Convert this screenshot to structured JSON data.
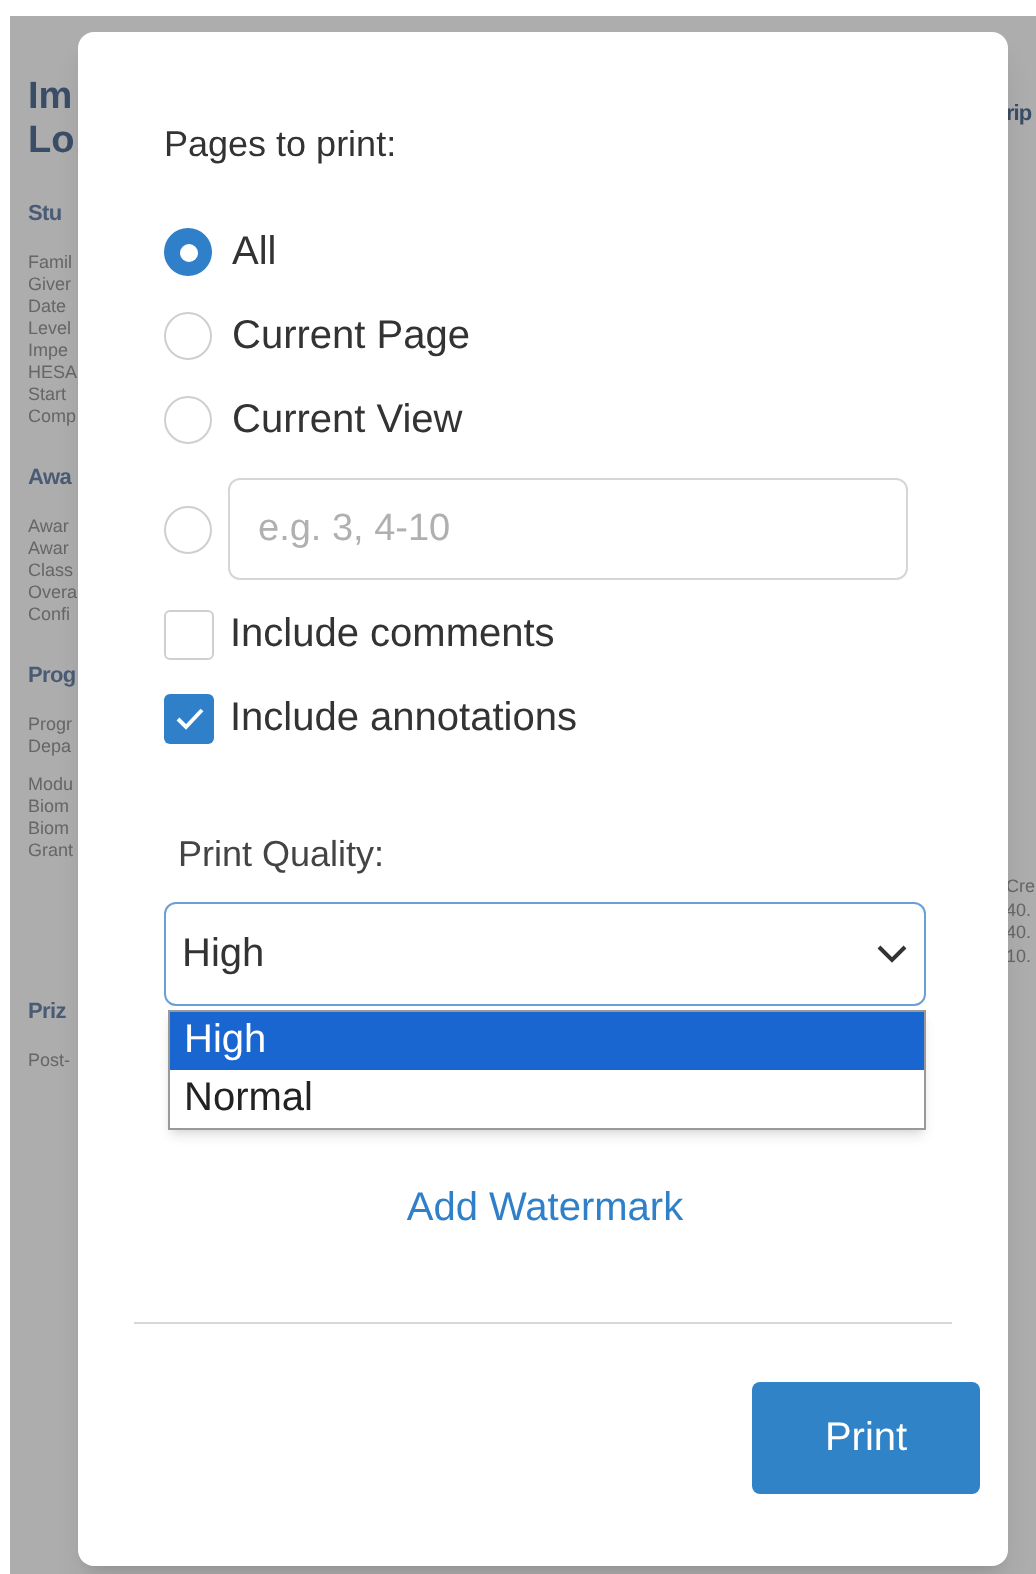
{
  "background": {
    "left": {
      "title": [
        "Im",
        "Lo"
      ],
      "sections": [
        {
          "heading": "Stu",
          "groups": [
            [
              "Famil",
              "Giver",
              "Date",
              "Level",
              "Impe",
              "HESA",
              "Start",
              "Comp"
            ]
          ]
        },
        {
          "heading": "Awa",
          "groups": [
            [
              "Awar",
              "Awar",
              "Class",
              "Overa",
              "Confi"
            ]
          ]
        },
        {
          "heading": "Prog",
          "groups": [
            [
              "Progr",
              "Depa"
            ],
            [
              "Modu",
              "Biom",
              "Biom",
              "Grant"
            ]
          ]
        },
        {
          "heading": "Priz",
          "groups": [
            [
              "Post-"
            ]
          ]
        }
      ]
    },
    "right": {
      "title": "rip",
      "cells": [
        "Cre",
        "40.",
        "40.",
        "10."
      ]
    }
  },
  "dialog": {
    "heading": "Pages to print:",
    "page_options": [
      {
        "kind": "choice",
        "label": "All",
        "selected": true
      },
      {
        "kind": "choice",
        "label": "Current Page",
        "selected": false
      },
      {
        "kind": "choice",
        "label": "Current View",
        "selected": false
      },
      {
        "kind": "range",
        "placeholder": "e.g. 3, 4-10",
        "selected": false
      }
    ],
    "checkboxes": [
      {
        "label": "Include comments",
        "checked": false
      },
      {
        "label": "Include annotations",
        "checked": true
      }
    ],
    "print_quality": {
      "label": "Print Quality:",
      "value": "High",
      "expanded": true,
      "options": [
        {
          "label": "High",
          "selected": true
        },
        {
          "label": "Normal",
          "selected": false
        }
      ]
    },
    "watermark_link": "Add Watermark",
    "print_button": "Print"
  }
}
